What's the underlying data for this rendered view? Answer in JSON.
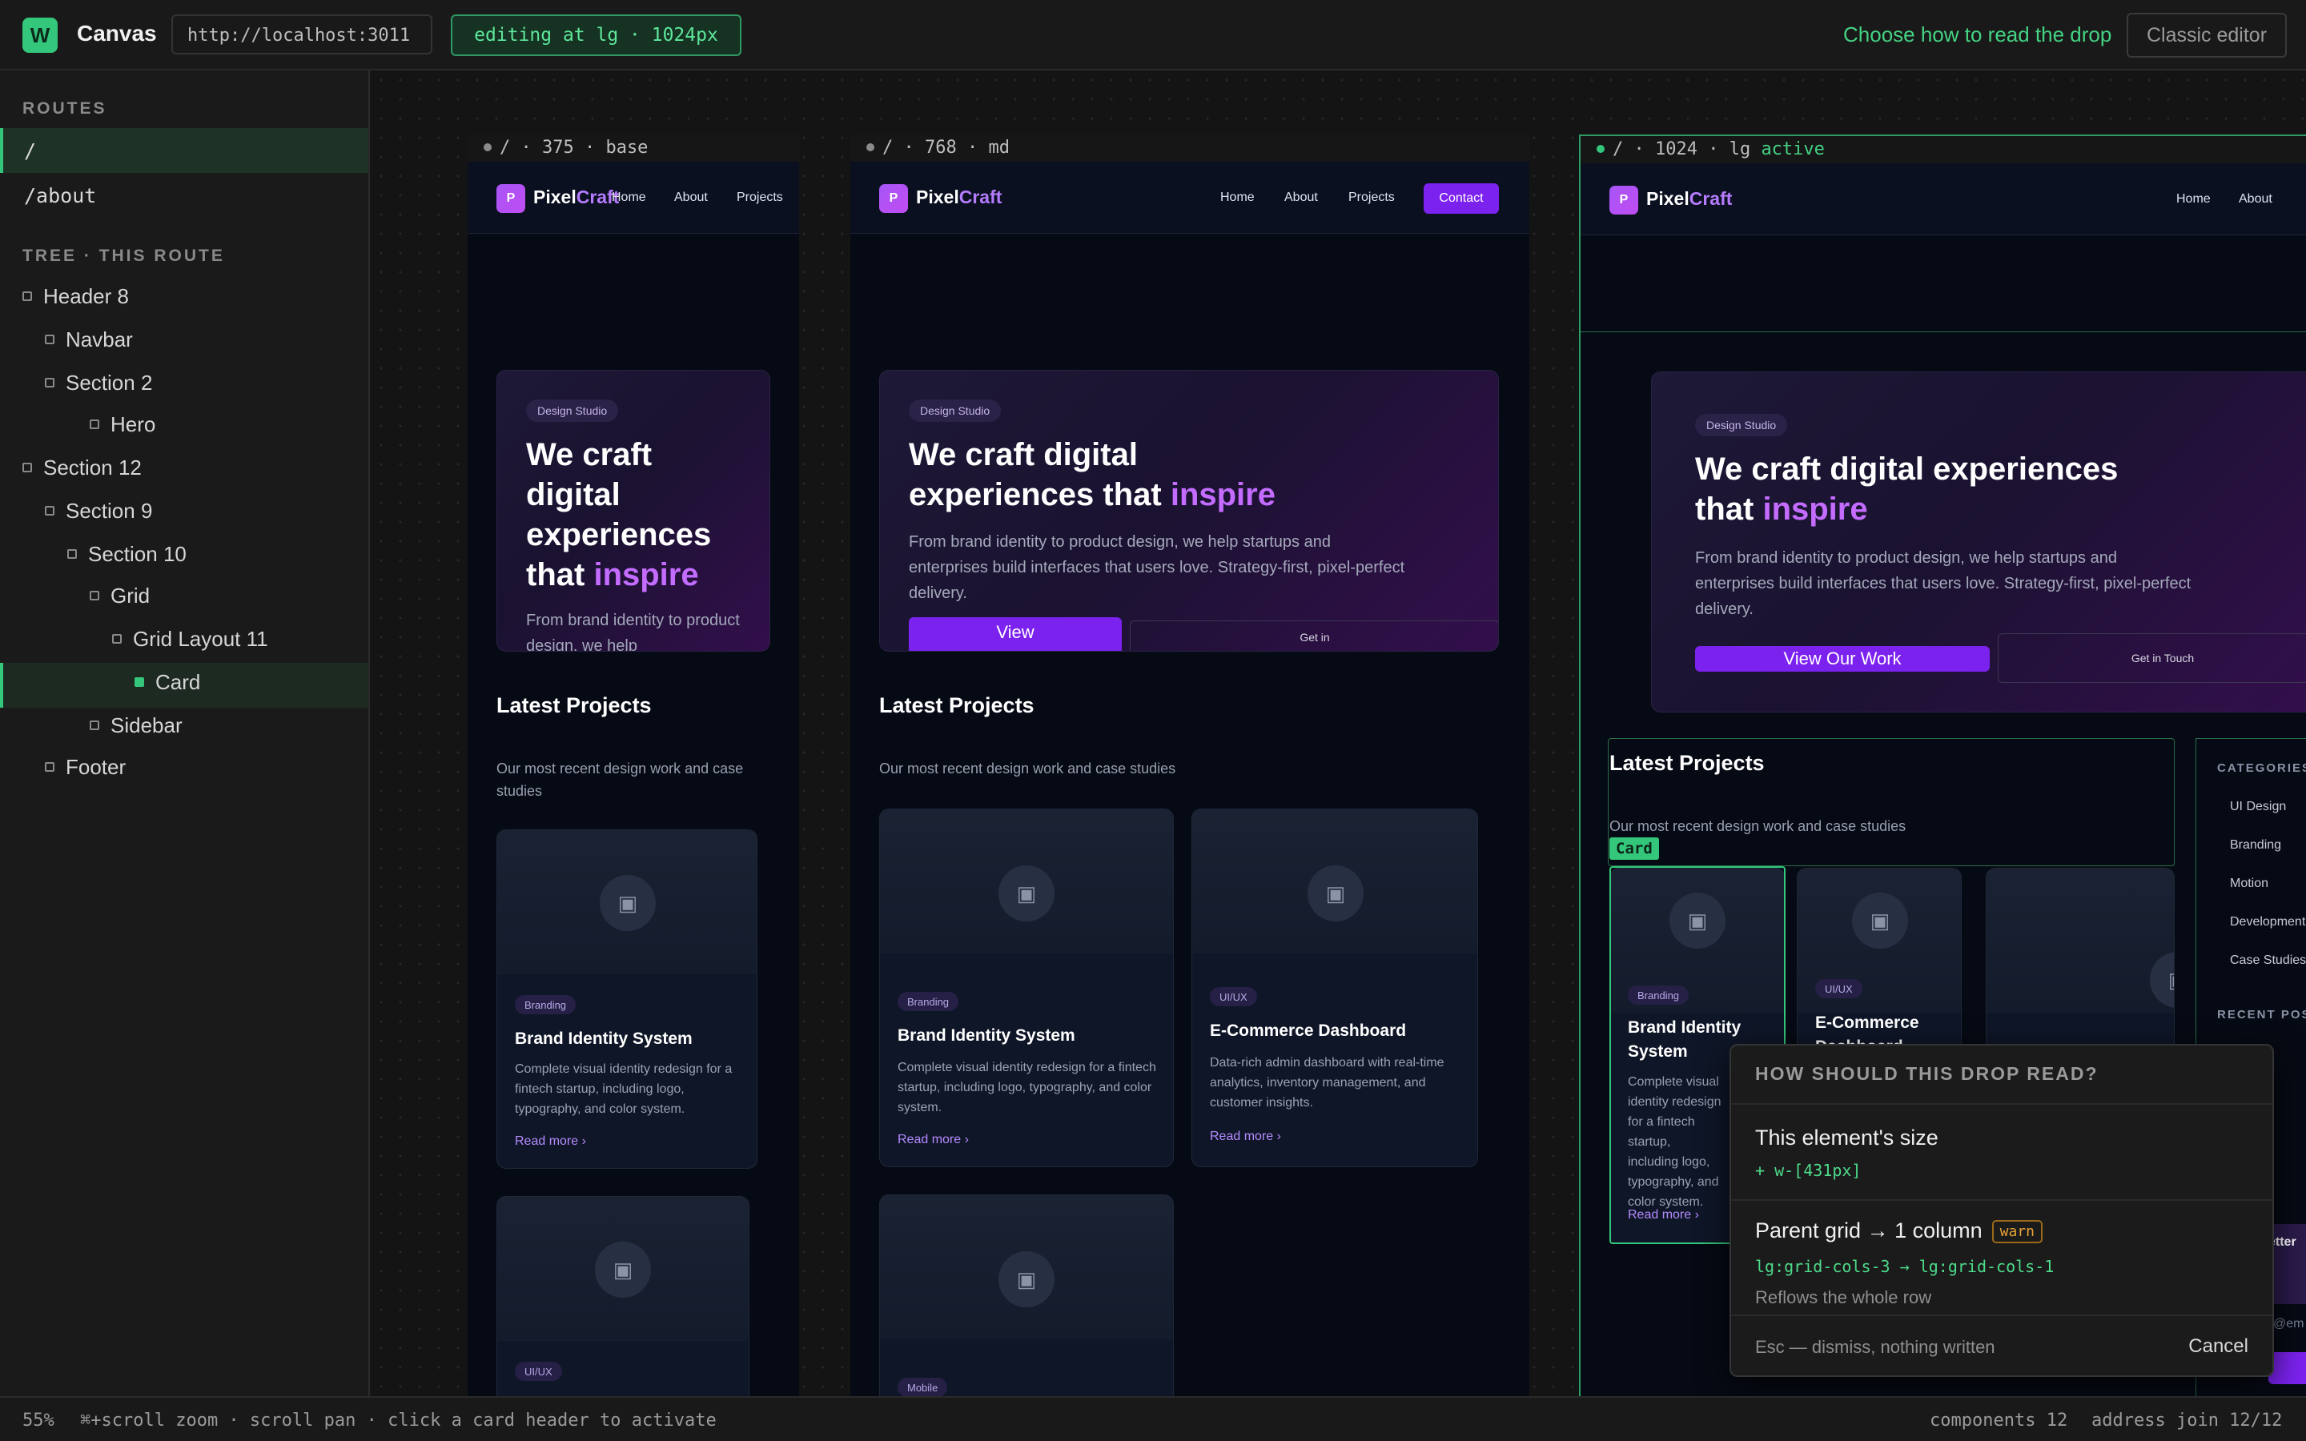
{
  "topbar": {
    "logo": "W",
    "title": "Canvas",
    "url": "http://localhost:3011",
    "edit_badge": "editing at lg · 1024px",
    "choose_link": "Choose how to read the drop",
    "classic_editor": "Classic editor"
  },
  "sidebar": {
    "routes_heading": "ROUTES",
    "routes": [
      "/",
      "/about"
    ],
    "tree_heading": "TREE · THIS ROUTE",
    "tree": [
      "Header 8",
      "Navbar",
      "Section 2",
      "Hero",
      "Section 12",
      "Section 9",
      "Section 10",
      "Grid",
      "Grid Layout 11",
      "Card",
      "Sidebar",
      "Footer"
    ]
  },
  "frames": {
    "base": {
      "label": "/ · 375 · base"
    },
    "md": {
      "label": "/ · 768 · md"
    },
    "lg": {
      "label": "/ · 1024 · lg",
      "active": "active"
    }
  },
  "site": {
    "brand_mark": "P",
    "brand_a": "Pixel",
    "brand_b": "Craft",
    "nav": [
      "Home",
      "About",
      "Projects",
      "Contact"
    ],
    "pill": "Design Studio",
    "hero_h_base": "We craft digital experiences that",
    "hero_h_highlight": "inspire",
    "hero_p": "From brand identity to product design, we help startups and enterprises build interfaces that users love. Strategy-first, pixel-perfect delivery.",
    "hero_p_base_cut": "From brand identity to product design, we help",
    "btn_primary": "View Our Work",
    "btn_primary_md_cut": "View",
    "btn_ghost": "Get in Touch",
    "btn_ghost_cut": "Get in",
    "latest_title": "Latest Projects",
    "latest_sub": "Our most recent design work and case studies",
    "read_more": "Read more",
    "cards": [
      {
        "tag": "Branding",
        "title": "Brand Identity System",
        "desc": "Complete visual identity redesign for a fintech startup, including logo, typography, and color system."
      },
      {
        "tag": "UI/UX",
        "title": "E-Commerce Dashboard",
        "desc": "Data-rich admin dashboard with real-time analytics, inventory management, and customer insights."
      },
      {
        "tag": "Mobile"
      }
    ],
    "categories_heading": "CATEGORIES",
    "categories": [
      "UI Design",
      "Branding",
      "Motion",
      "Development",
      "Case Studies"
    ],
    "recent_heading": "RECENT POS",
    "newsletter_cut": "etter",
    "email_cut": "@em"
  },
  "selection": {
    "tag": "Card"
  },
  "popover": {
    "heading": "HOW SHOULD THIS DROP READ?",
    "opt1_title": "This element's size",
    "opt1_code": "+ w-[431px]",
    "opt2_title": "Parent grid → 1 column",
    "opt2_warn": "warn",
    "opt2_code": "lg:grid-cols-3 → lg:grid-cols-1",
    "opt2_note": "Reflows the whole row",
    "dismiss": "Esc — dismiss, nothing written",
    "cancel": "Cancel"
  },
  "statusbar": {
    "zoom": "55%",
    "hint": "⌘+scroll zoom · scroll pan · click a card header to activate",
    "components": "components 12",
    "address": "address join 12/12"
  },
  "colors": {
    "accent": "#34c77b",
    "brand": "#7c22ef",
    "highlight": "#c46cff",
    "warn": "#e7a437"
  }
}
